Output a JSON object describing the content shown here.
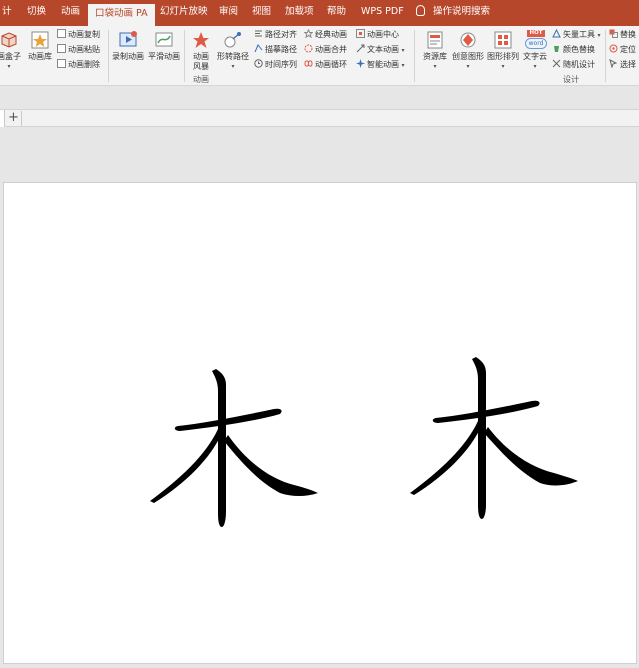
{
  "tabs": [
    {
      "label": "计"
    },
    {
      "label": "切换"
    },
    {
      "label": "动画"
    },
    {
      "label": "口袋动画 PA",
      "active": true
    },
    {
      "label": "幻灯片放映"
    },
    {
      "label": "审阅"
    },
    {
      "label": "视图"
    },
    {
      "label": "加载项"
    },
    {
      "label": "帮助"
    },
    {
      "label": "WPS PDF"
    },
    {
      "label": "操作说明搜索"
    }
  ],
  "ribbon": {
    "anim_box": "画盒子",
    "anim_lib": "动画库",
    "anim_copy": "动画复制",
    "anim_paste": "动画粘贴",
    "anim_delete": "动画删除",
    "record_anim": "录制动画",
    "smooth_anim": "平滑动画",
    "anim_style_1": "动画",
    "anim_style_2": "风暴",
    "morph_path": "形转路径",
    "path_align": "路径对齐",
    "trace_path": "描摹路径",
    "time_sequence": "时间序列",
    "classic_anim": "经典动画",
    "anim_merge": "动画合并",
    "anim_loop": "动画循环",
    "anim_center": "动画中心",
    "text_anim": "文本动画",
    "smart_anim": "智能动画",
    "group_anim_label": "动画",
    "resource_lib": "资源库",
    "creative_shape": "创意图形",
    "shape_arrange": "图形排列",
    "word_cloud": "文字云",
    "word_cloud_badge": "HOT",
    "word_cloud_sub": "word",
    "vector_tool": "矢量工具",
    "color_replace": "颜色替换",
    "random_design": "随机设计",
    "replace": "替换",
    "locate": "定位",
    "select": "选择",
    "group_design_label": "设计"
  },
  "slide": {
    "characters": [
      "木",
      "木"
    ]
  },
  "colors": {
    "accent": "#b7472a",
    "ribbon_bg": "#f3f3f3",
    "workspace_bg": "#e6e6e6",
    "glyph": "#000000"
  }
}
